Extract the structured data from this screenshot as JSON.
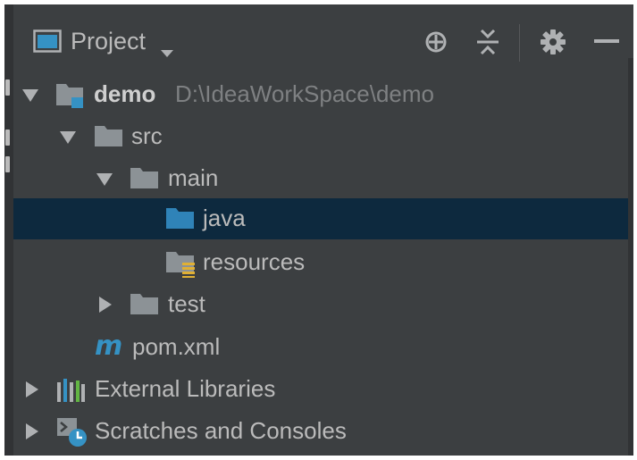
{
  "panel": {
    "title": "Project"
  },
  "toolbar": {
    "icons": [
      "locate-icon",
      "collapse-all-icon",
      "gear-icon",
      "minimize-icon"
    ]
  },
  "tree": {
    "items": [
      {
        "label": "demo",
        "path": "D:\\IdeaWorkSpace\\demo",
        "expanded": true,
        "icon": "module-folder-icon"
      },
      {
        "label": "src",
        "expanded": true,
        "icon": "folder-icon"
      },
      {
        "label": "main",
        "expanded": true,
        "icon": "folder-icon"
      },
      {
        "label": "java",
        "selected": true,
        "icon": "source-folder-icon"
      },
      {
        "label": "resources",
        "icon": "resources-folder-icon"
      },
      {
        "label": "test",
        "expanded": false,
        "icon": "folder-icon"
      },
      {
        "label": "pom.xml",
        "icon": "maven-icon"
      },
      {
        "label": "External Libraries",
        "expanded": false,
        "icon": "libraries-icon"
      },
      {
        "label": "Scratches and Consoles",
        "expanded": false,
        "icon": "scratches-icon"
      }
    ]
  },
  "colors": {
    "background": "#3c3f41",
    "selection": "#0d293e",
    "text": "#bbbbbb",
    "path_text": "#7e8082",
    "folder": "#8c9296",
    "source_folder": "#2f83b8",
    "accent_blue": "#3592c4"
  }
}
